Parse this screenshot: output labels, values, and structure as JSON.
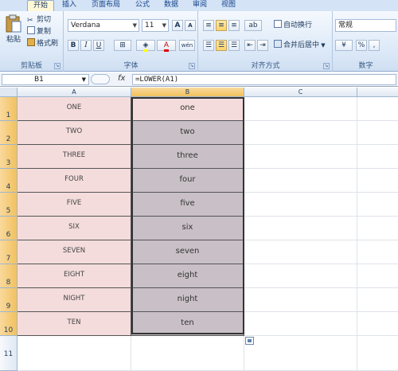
{
  "tabs": [
    "开始",
    "插入",
    "页面布局",
    "公式",
    "数据",
    "审阅",
    "视图"
  ],
  "clipboard": {
    "paste": "粘贴",
    "cut": "剪切",
    "copy": "复制",
    "format_painter": "格式刷",
    "label": "剪贴板"
  },
  "font": {
    "name": "Verdana",
    "size": "11",
    "grow": "A",
    "shrink": "A",
    "bold": "B",
    "italic": "I",
    "underline": "U",
    "color_letter": "A",
    "phonetic": "wén",
    "label": "字体"
  },
  "alignment": {
    "wrap": "自动换行",
    "merge": "合并后居中",
    "label": "对齐方式"
  },
  "number": {
    "format": "常规",
    "percent": "%",
    "comma": ",",
    "label": "数字"
  },
  "formula_bar": {
    "name_box": "B1",
    "fx": "fx",
    "formula": "=LOWER(A1)"
  },
  "columns": [
    "A",
    "B",
    "C"
  ],
  "rows": [
    "1",
    "2",
    "3",
    "4",
    "5",
    "6",
    "7",
    "8",
    "9",
    "10",
    "11"
  ],
  "col_a": [
    "ONE",
    "TWO",
    "THREE",
    "FOUR",
    "FIVE",
    "SIX",
    "SEVEN",
    "EIGHT",
    "NIGHT",
    "TEN"
  ],
  "col_b": [
    "one",
    "two",
    "three",
    "four",
    "five",
    "six",
    "seven",
    "eight",
    "night",
    "ten"
  ],
  "colors": {
    "tab_bg": "#d4e4f6",
    "col_a_fill": "#f4dcdc",
    "col_b_fill": "#c8c0c6",
    "header_select": "#f1c15f"
  }
}
